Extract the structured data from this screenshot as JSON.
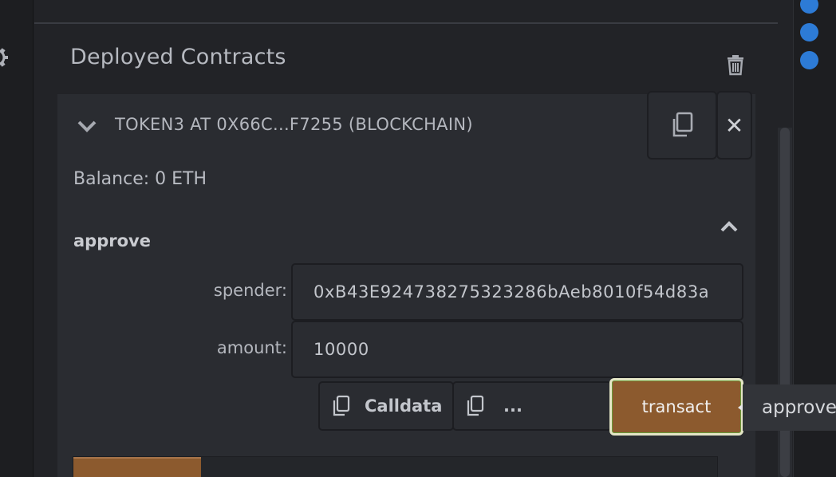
{
  "section": {
    "title": "Deployed Contracts"
  },
  "contract": {
    "title": "TOKEN3 AT 0X66C...F7255 (BLOCKCHAIN)",
    "balance": "Balance: 0 ETH"
  },
  "function": {
    "name": "approve",
    "params": [
      {
        "label": "spender:",
        "value": "0xB43E924738275323286bAeb8010f54d83a"
      },
      {
        "label": "amount:",
        "value": "10000"
      }
    ],
    "calldata_label": "Calldata",
    "dots_label": "...",
    "transact_label": "transact",
    "tooltip": "approve"
  },
  "colors": {
    "accent_orange": "#8c5a2e",
    "status_blue": "#2d7bd6"
  },
  "icons": [
    "gear-icon",
    "trash-icon",
    "chevron-down-icon",
    "copy-icon",
    "close-icon",
    "chevron-up-icon"
  ]
}
